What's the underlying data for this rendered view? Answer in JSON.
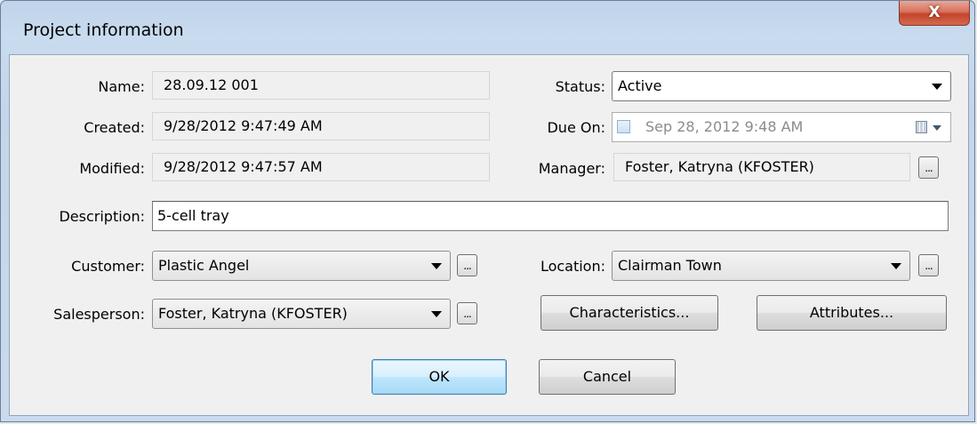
{
  "window": {
    "title": "Project information",
    "close_label": "X"
  },
  "fields": {
    "name": {
      "label": "Name:",
      "value": "28.09.12 001"
    },
    "created": {
      "label": "Created:",
      "value": "9/28/2012 9:47:49 AM"
    },
    "modified": {
      "label": "Modified:",
      "value": "9/28/2012 9:47:57 AM"
    },
    "status": {
      "label": "Status:",
      "value": "Active"
    },
    "due_on": {
      "label": "Due On:",
      "value": "Sep 28, 2012  9:48 AM",
      "checked": false
    },
    "manager": {
      "label": "Manager:",
      "value": "Foster, Katryna (KFOSTER)"
    },
    "description": {
      "label": "Description:",
      "value": "5-cell tray"
    },
    "customer": {
      "label": "Customer:",
      "value": "Plastic Angel"
    },
    "location": {
      "label": "Location:",
      "value": "Clairman Town"
    },
    "salesperson": {
      "label": "Salesperson:",
      "value": "Foster, Katryna (KFOSTER)"
    }
  },
  "browse_label": "...",
  "buttons": {
    "characteristics": "Characteristics...",
    "attributes": "Attributes...",
    "ok": "OK",
    "cancel": "Cancel"
  },
  "icons": {
    "close": "close-icon",
    "dropdown": "chevron-down-icon",
    "calendar": "calendar-icon"
  },
  "colors": {
    "frame": "#c3d5ea",
    "close_button": "#c4442b",
    "default_button_border": "#3c7fb1"
  }
}
